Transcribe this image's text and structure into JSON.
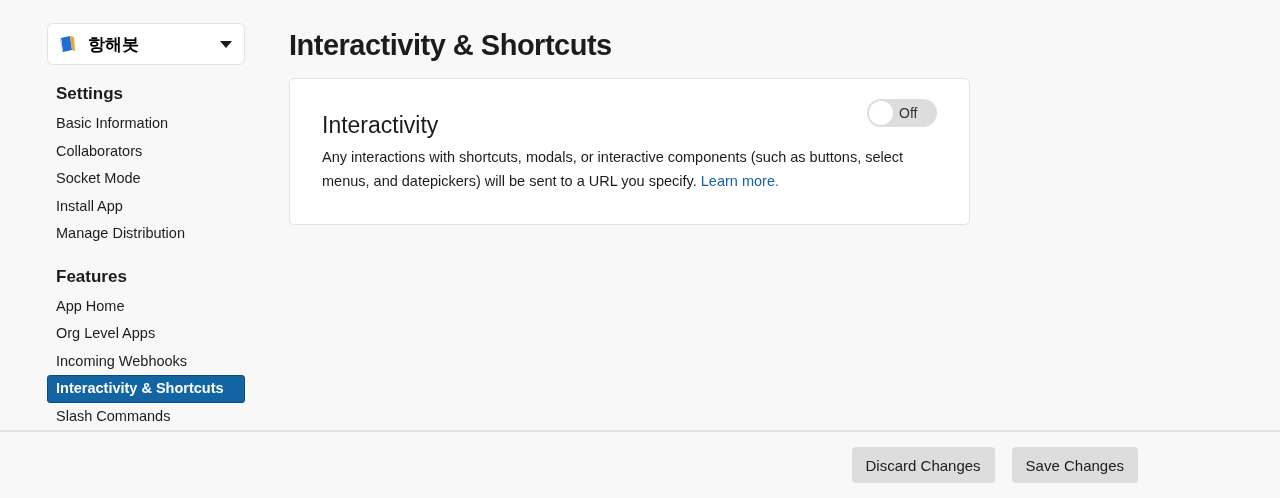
{
  "app_switcher": {
    "name": "항해봇"
  },
  "sidebar": {
    "sections": [
      {
        "heading": "Settings",
        "items": [
          {
            "label": "Basic Information",
            "selected": false
          },
          {
            "label": "Collaborators",
            "selected": false
          },
          {
            "label": "Socket Mode",
            "selected": false
          },
          {
            "label": "Install App",
            "selected": false
          },
          {
            "label": "Manage Distribution",
            "selected": false
          }
        ]
      },
      {
        "heading": "Features",
        "items": [
          {
            "label": "App Home",
            "selected": false
          },
          {
            "label": "Org Level Apps",
            "selected": false
          },
          {
            "label": "Incoming Webhooks",
            "selected": false
          },
          {
            "label": "Interactivity & Shortcuts",
            "selected": true
          },
          {
            "label": "Slash Commands",
            "selected": false
          }
        ]
      }
    ]
  },
  "page_title": "Interactivity & Shortcuts",
  "card": {
    "title": "Interactivity",
    "toggle": {
      "on": false,
      "label": "Off"
    },
    "description": "Any interactions with shortcuts, modals, or interactive components (such as buttons, select menus, and datepickers) will be sent to a URL you specify.",
    "link": "Learn more."
  },
  "footer": {
    "buttons": [
      {
        "label": "Discard Changes",
        "disabled": true
      },
      {
        "label": "Save Changes",
        "disabled": true
      }
    ]
  }
}
